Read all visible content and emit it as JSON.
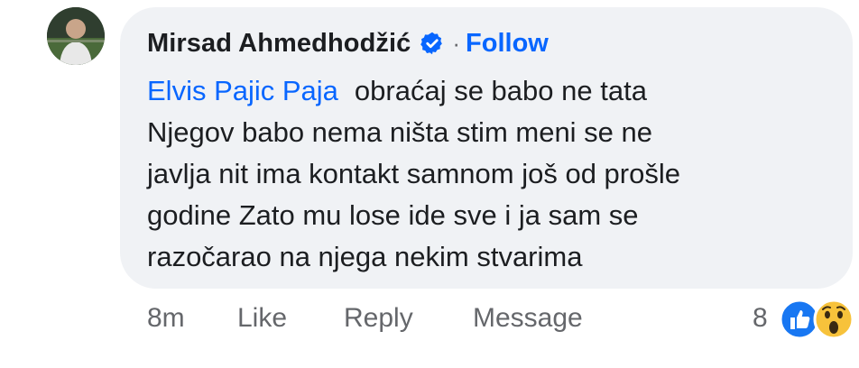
{
  "comment": {
    "author_name": "Mirsad Ahmedhodžić",
    "separator": "·",
    "follow_label": "Follow",
    "mention": "Elvis Pajic Paja",
    "lines": [
      "obraćaj se babo ne tata",
      "Njegov babo nema ništa stim meni se ne",
      "javlja nit ima kontakt samnom još od prošle",
      "godine Zato mu lose ide  sve i ja sam se",
      "razočarao na njega nekim stvarima"
    ]
  },
  "actions": {
    "timestamp": "8m",
    "like_label": "Like",
    "reply_label": "Reply",
    "message_label": "Message"
  },
  "reactions": {
    "count": "8",
    "icons": [
      "like-reaction-icon",
      "wow-reaction-icon"
    ]
  },
  "colors": {
    "bubble_bg": "#f0f2f5",
    "link_blue": "#0866ff",
    "secondary_text": "#65676b",
    "primary_text": "#1c1e21"
  }
}
